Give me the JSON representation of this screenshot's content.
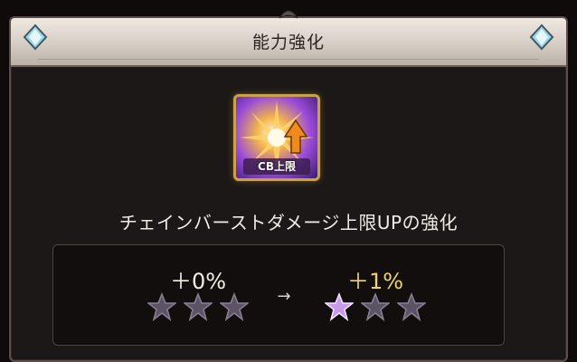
{
  "dialog": {
    "title": "能力強化"
  },
  "skill": {
    "icon_label": "CB上限",
    "icon": "chain-burst-cap-up-icon",
    "name": "チェインバーストダメージ上限UPの強化"
  },
  "comparison": {
    "current_value": "＋0%",
    "arrow": "→",
    "next_value": "＋1%",
    "current_stars": {
      "filled": 0,
      "total": 3
    },
    "next_stars": {
      "filled": 1,
      "total": 3
    }
  },
  "colors": {
    "title_bar": "#e4ddd5",
    "next_value": "#f0d36a",
    "star_filled": "#c79be8",
    "star_empty": "#5c5366"
  }
}
